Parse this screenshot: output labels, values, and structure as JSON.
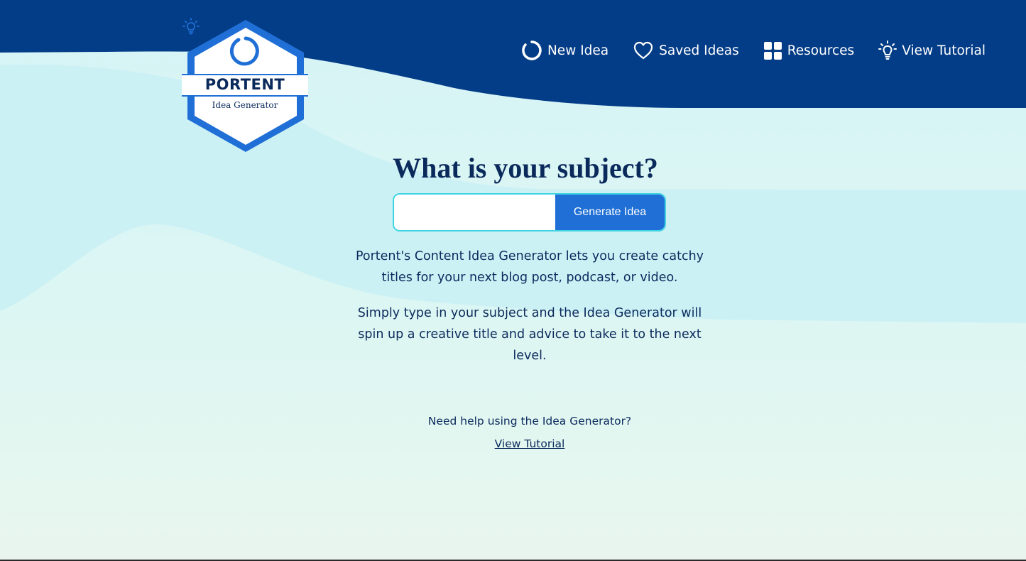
{
  "brand": {
    "name": "PORTENT",
    "tagline": "Idea Generator"
  },
  "nav": {
    "items": [
      {
        "label": "New Idea",
        "icon": "refresh-circle-icon"
      },
      {
        "label": "Saved Ideas",
        "icon": "heart-icon"
      },
      {
        "label": "Resources",
        "icon": "grid-icon"
      },
      {
        "label": "View Tutorial",
        "icon": "lightbulb-icon"
      }
    ]
  },
  "main": {
    "headline": "What is your subject?",
    "input": {
      "value": "",
      "placeholder": ""
    },
    "generate_label": "Generate Idea",
    "description_1": "Portent's Content Idea Generator lets you create catchy titles for your next blog post, podcast, or video.",
    "description_2": "Simply type in your subject and the Idea Generator will spin up a creative title and advice to take it to the next level.",
    "help_text": "Need help using the Idea Generator?",
    "help_link": "View Tutorial"
  },
  "colors": {
    "header_navy": "#043d87",
    "accent_blue": "#1f6fd6",
    "input_border": "#3fd4e2",
    "text_navy": "#0b2a5c"
  }
}
